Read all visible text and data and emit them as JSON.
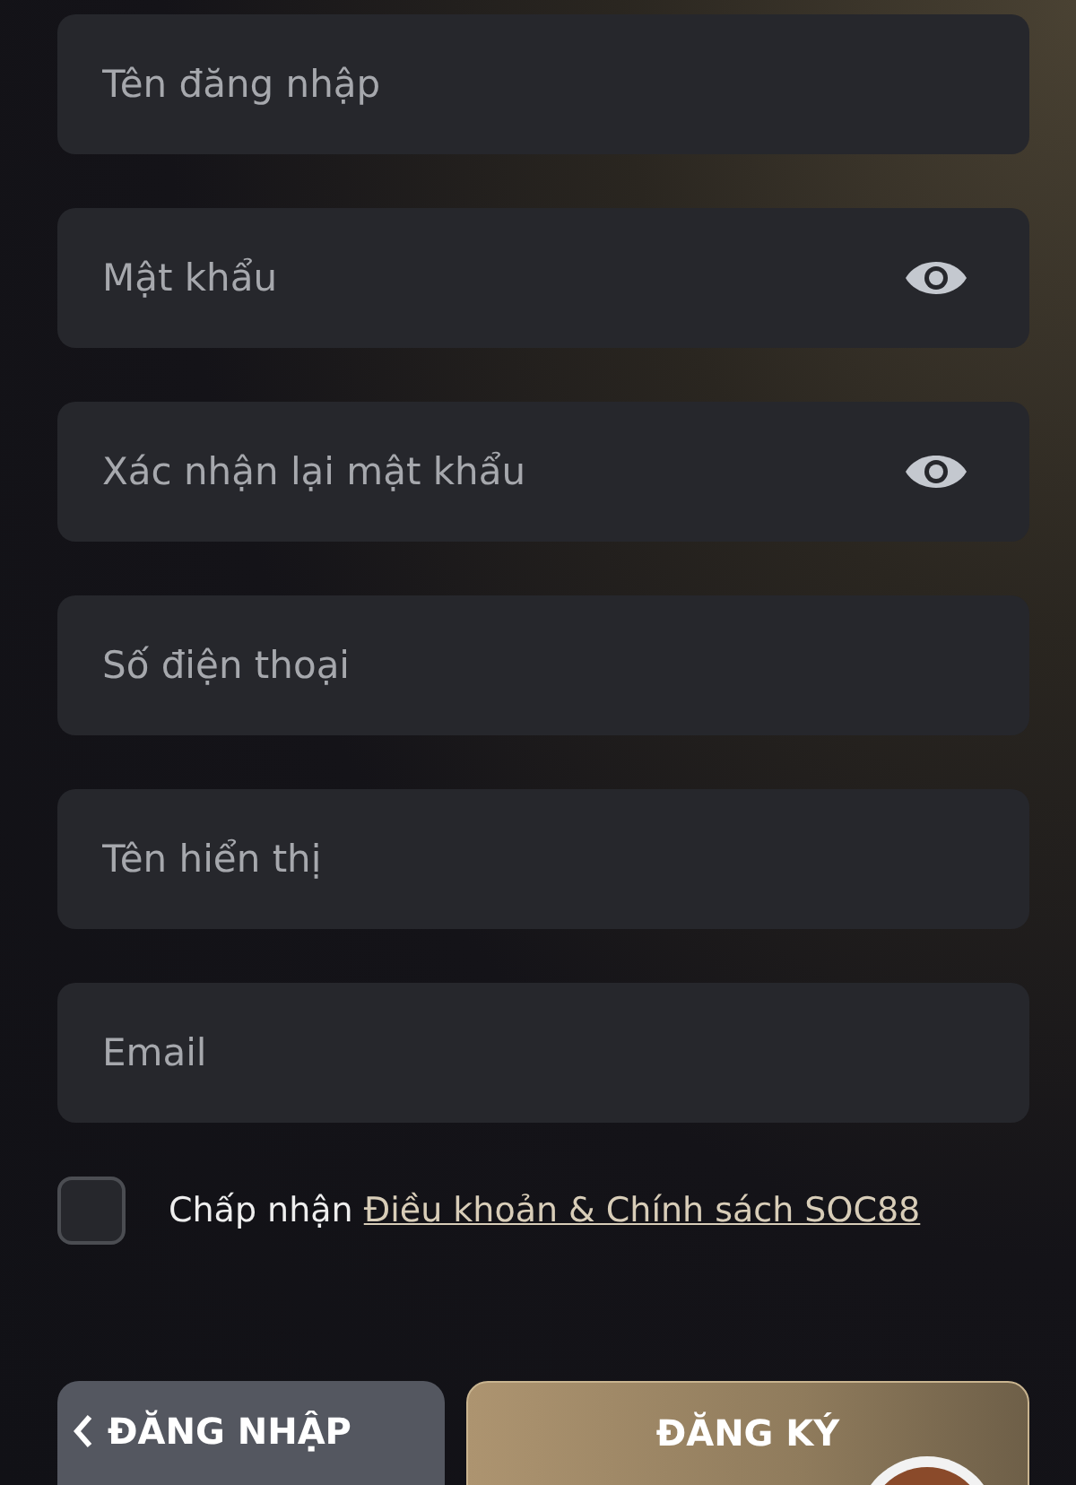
{
  "fields": [
    {
      "kind": "text",
      "placeholder": "Tên đăng nhập"
    },
    {
      "kind": "password",
      "placeholder": "Mật khẩu"
    },
    {
      "kind": "password",
      "placeholder": "Xác nhận lại mật khẩu"
    },
    {
      "kind": "text",
      "placeholder": "Số điện thoại"
    },
    {
      "kind": "text",
      "placeholder": "Tên hiển thị"
    },
    {
      "kind": "text",
      "placeholder": "Email"
    }
  ],
  "terms": {
    "checked": false,
    "label": "Chấp nhận",
    "link": "Điều khoản & Chính sách SOC88"
  },
  "buttons": [
    {
      "kind": "back",
      "label": "ĐĂNG NHẬP"
    },
    {
      "kind": "primary",
      "label": "ĐĂNG KÝ"
    }
  ]
}
